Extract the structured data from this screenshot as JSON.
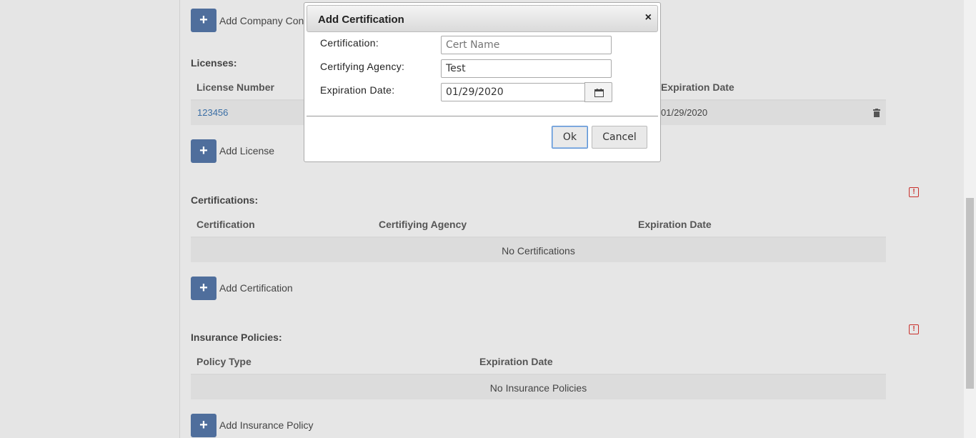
{
  "company_contacts": {
    "add_label": "Add Company Conta"
  },
  "licenses": {
    "title": "Licenses:",
    "headers": [
      "License Number",
      "Expiration Date"
    ],
    "rows": [
      {
        "number": "123456",
        "expiration": "01/29/2020"
      }
    ],
    "add_label": "Add License"
  },
  "certifications": {
    "title": "Certifications:",
    "headers": [
      "Certification",
      "Certifiying Agency",
      "Expiration Date"
    ],
    "empty_message": "No Certifications",
    "add_label": "Add Certification"
  },
  "insurance": {
    "title": "Insurance Policies:",
    "headers": [
      "Policy Type",
      "Expiration Date"
    ],
    "empty_message": "No Insurance Policies",
    "add_label": "Add Insurance Policy"
  },
  "dialog": {
    "title": "Add Certification",
    "close": "×",
    "fields": {
      "certification": {
        "label": "Certification:",
        "value": "",
        "placeholder": "Cert Name"
      },
      "agency": {
        "label": "Certifying Agency:",
        "value": "Test"
      },
      "expiration": {
        "label": "Expiration Date:",
        "value": "01/29/2020"
      }
    },
    "ok_label": "Ok",
    "cancel_label": "Cancel"
  },
  "icons": {
    "add": "+",
    "warning": "!",
    "delete": "trash-icon",
    "calendar": "calendar-icon"
  },
  "colors": {
    "add_button": "#4f6e9c",
    "link": "#3a6ea5",
    "warning": "#c9302c"
  }
}
